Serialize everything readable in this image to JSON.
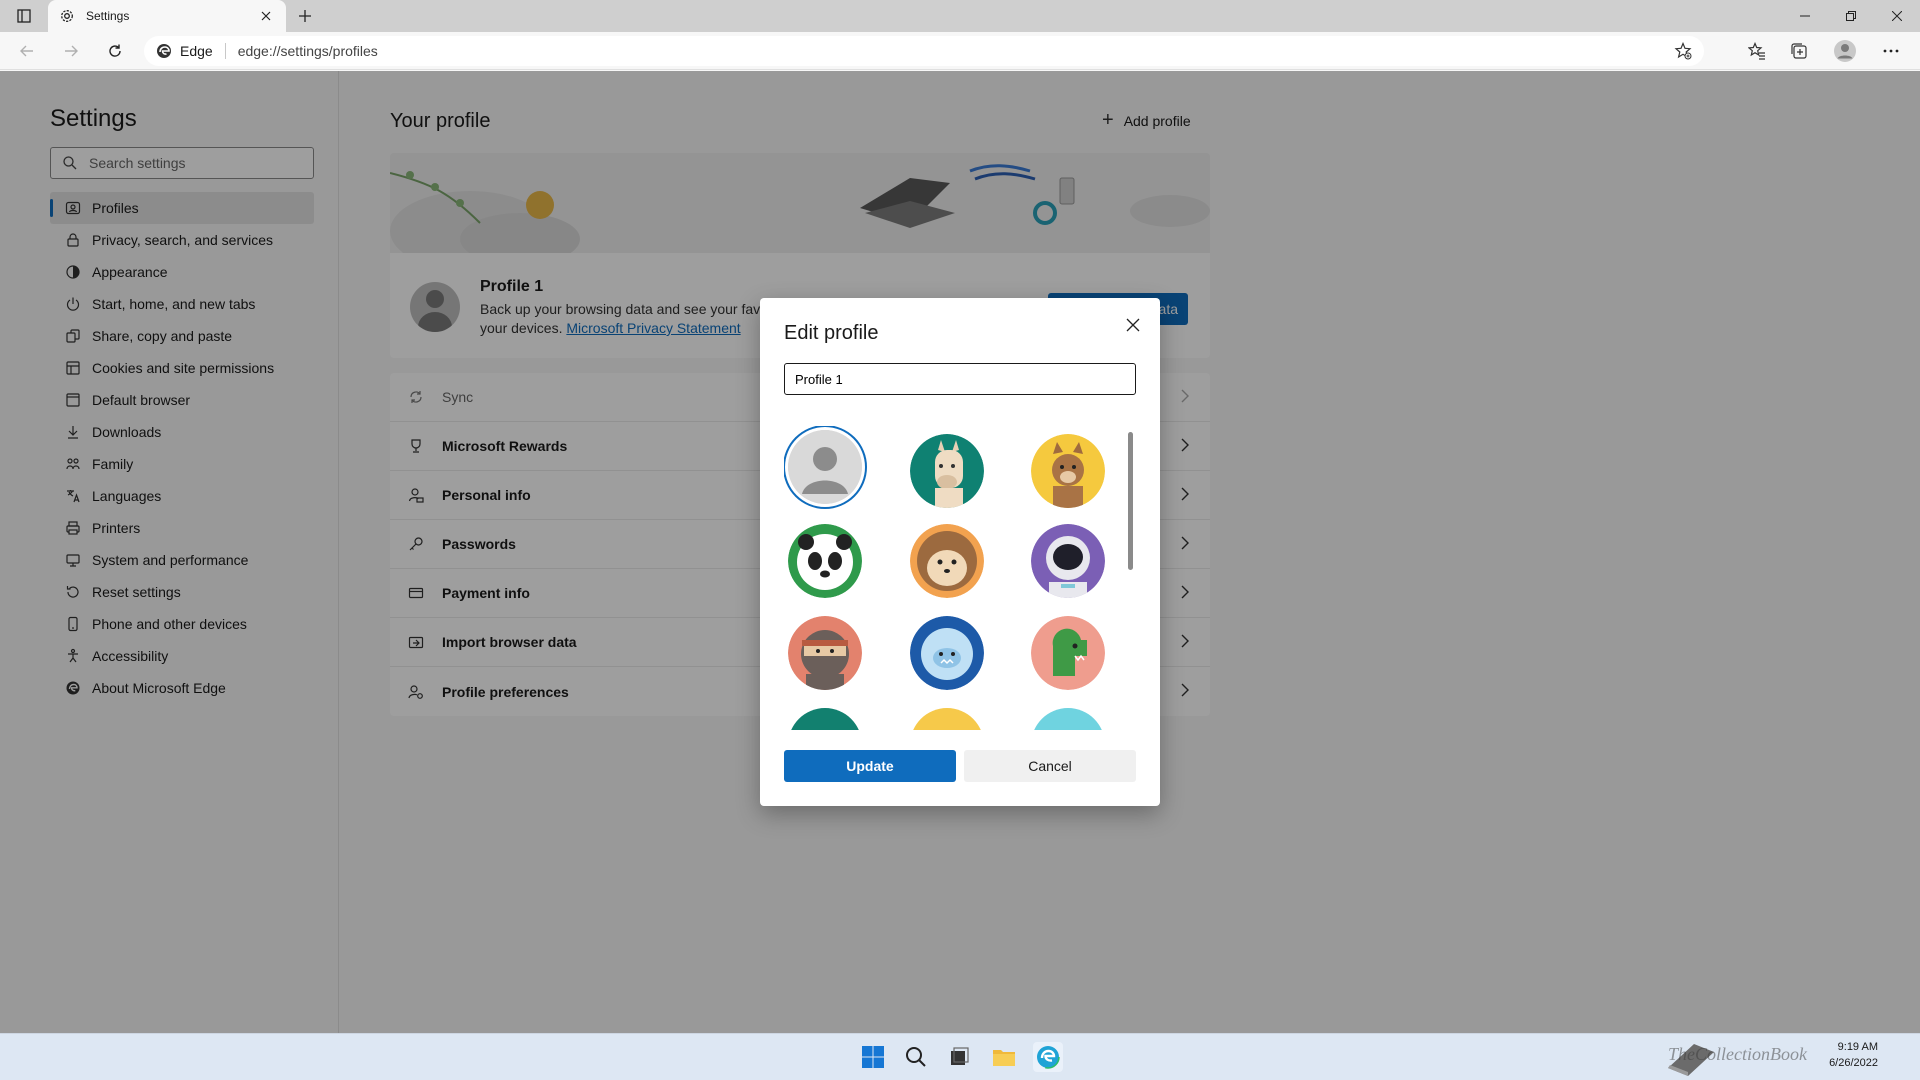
{
  "browser": {
    "tab_title": "Settings",
    "site_label": "Edge",
    "url": "edge://settings/profiles"
  },
  "sidebar": {
    "title": "Settings",
    "search_placeholder": "Search settings",
    "items": [
      {
        "label": "Profiles",
        "icon": "profile-icon",
        "active": true
      },
      {
        "label": "Privacy, search, and services",
        "icon": "lock-icon"
      },
      {
        "label": "Appearance",
        "icon": "appearance-icon"
      },
      {
        "label": "Start, home, and new tabs",
        "icon": "power-icon"
      },
      {
        "label": "Share, copy and paste",
        "icon": "share-icon"
      },
      {
        "label": "Cookies and site permissions",
        "icon": "cookie-icon"
      },
      {
        "label": "Default browser",
        "icon": "browser-icon"
      },
      {
        "label": "Downloads",
        "icon": "download-icon"
      },
      {
        "label": "Family",
        "icon": "family-icon"
      },
      {
        "label": "Languages",
        "icon": "language-icon"
      },
      {
        "label": "Printers",
        "icon": "printer-icon"
      },
      {
        "label": "System and performance",
        "icon": "system-icon"
      },
      {
        "label": "Reset settings",
        "icon": "reset-icon"
      },
      {
        "label": "Phone and other devices",
        "icon": "phone-icon"
      },
      {
        "label": "Accessibility",
        "icon": "accessibility-icon"
      },
      {
        "label": "About Microsoft Edge",
        "icon": "edge-icon"
      }
    ]
  },
  "main": {
    "heading": "Your profile",
    "add_profile_label": "Add profile",
    "profile_name": "Profile 1",
    "profile_desc": "Back up your browsing data and see your fav",
    "profile_desc_2": "your devices.",
    "privacy_link": "Microsoft Privacy Statement",
    "manage_button_partial": "ata",
    "rows": [
      {
        "label": "Sync",
        "icon": "sync-icon",
        "muted": true
      },
      {
        "label": "Microsoft Rewards",
        "icon": "rewards-icon"
      },
      {
        "label": "Personal info",
        "icon": "personal-info-icon"
      },
      {
        "label": "Passwords",
        "icon": "key-icon"
      },
      {
        "label": "Payment info",
        "icon": "card-icon"
      },
      {
        "label": "Import browser data",
        "icon": "import-icon"
      },
      {
        "label": "Profile preferences",
        "icon": "preferences-icon"
      }
    ]
  },
  "dialog": {
    "title": "Edit profile",
    "name_value": "Profile 1",
    "update_label": "Update",
    "cancel_label": "Cancel",
    "avatars": [
      "default",
      "llama",
      "cat",
      "panda",
      "hedgehog",
      "astronaut",
      "ninja",
      "yeti",
      "dinosaur",
      "partial-1",
      "partial-2",
      "partial-3"
    ],
    "selected_avatar": "default"
  },
  "taskbar": {
    "time": "9:19 AM",
    "date": "6/26/2022",
    "watermark": "TheCollectionBook"
  },
  "colors": {
    "accent": "#0f6cbd",
    "overlay": "rgba(0,0,0,0.38)"
  }
}
